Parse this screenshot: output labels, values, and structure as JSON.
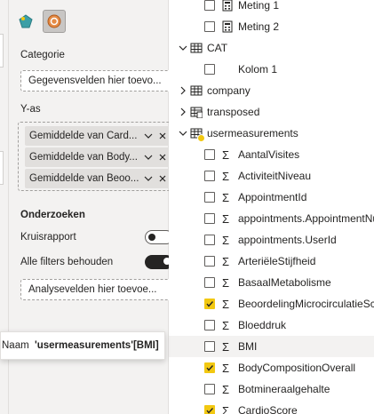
{
  "colors": {
    "accent_yellow": "#f2c811",
    "pane_bg": "#f3f2f1",
    "text": "#252423"
  },
  "visualizations": {
    "icons": [
      {
        "name": "fields-build-icon",
        "active": false
      },
      {
        "name": "format-paint-icon",
        "active": true
      }
    ]
  },
  "wells": {
    "categorie": {
      "label": "Categorie",
      "placeholder": "Gegevensvelden hier toevo..."
    },
    "y_as": {
      "label": "Y-as",
      "fields": [
        {
          "label": "Gemiddelde van Card..."
        },
        {
          "label": "Gemiddelde van Body..."
        },
        {
          "label": "Gemiddelde van Beoo..."
        }
      ]
    }
  },
  "onderzoeken": {
    "label": "Onderzoeken",
    "toggles": [
      {
        "label": "Kruisrapport",
        "on": false
      },
      {
        "label": "Alle filters behouden",
        "on": true
      }
    ],
    "analysis_placeholder": "Analysevelden hier toevoe..."
  },
  "tooltip": {
    "key": "Naam",
    "value": "'usermeasurements'[BMI]"
  },
  "tree": {
    "meting_rows": [
      {
        "label": "Meting 1",
        "checked": false
      },
      {
        "label": "Meting 2",
        "checked": false
      }
    ],
    "cat": {
      "label": "CAT",
      "child": "Kolom 1"
    },
    "company": {
      "label": "company"
    },
    "transposed": {
      "label": "transposed"
    },
    "usermeasurements": {
      "label": "usermeasurements",
      "fields": [
        {
          "label": "AantalVisites",
          "checked": false
        },
        {
          "label": "ActiviteitNiveau",
          "checked": false
        },
        {
          "label": "AppointmentId",
          "checked": false
        },
        {
          "label": "appointments.AppointmentNumber",
          "checked": false
        },
        {
          "label": "appointments.UserId",
          "checked": false
        },
        {
          "label": "ArteriëleStijfheid",
          "checked": false
        },
        {
          "label": "BasaalMetabolisme",
          "checked": false
        },
        {
          "label": "BeoordelingMicrocirculatieScore",
          "checked": true
        },
        {
          "label": "Bloeddruk",
          "checked": false
        },
        {
          "label": "BMI",
          "checked": false
        },
        {
          "label": "BodyCompositionOverall",
          "checked": true
        },
        {
          "label": "Botmineraalgehalte",
          "checked": false
        },
        {
          "label": "CardioScore",
          "checked": true
        }
      ]
    }
  }
}
